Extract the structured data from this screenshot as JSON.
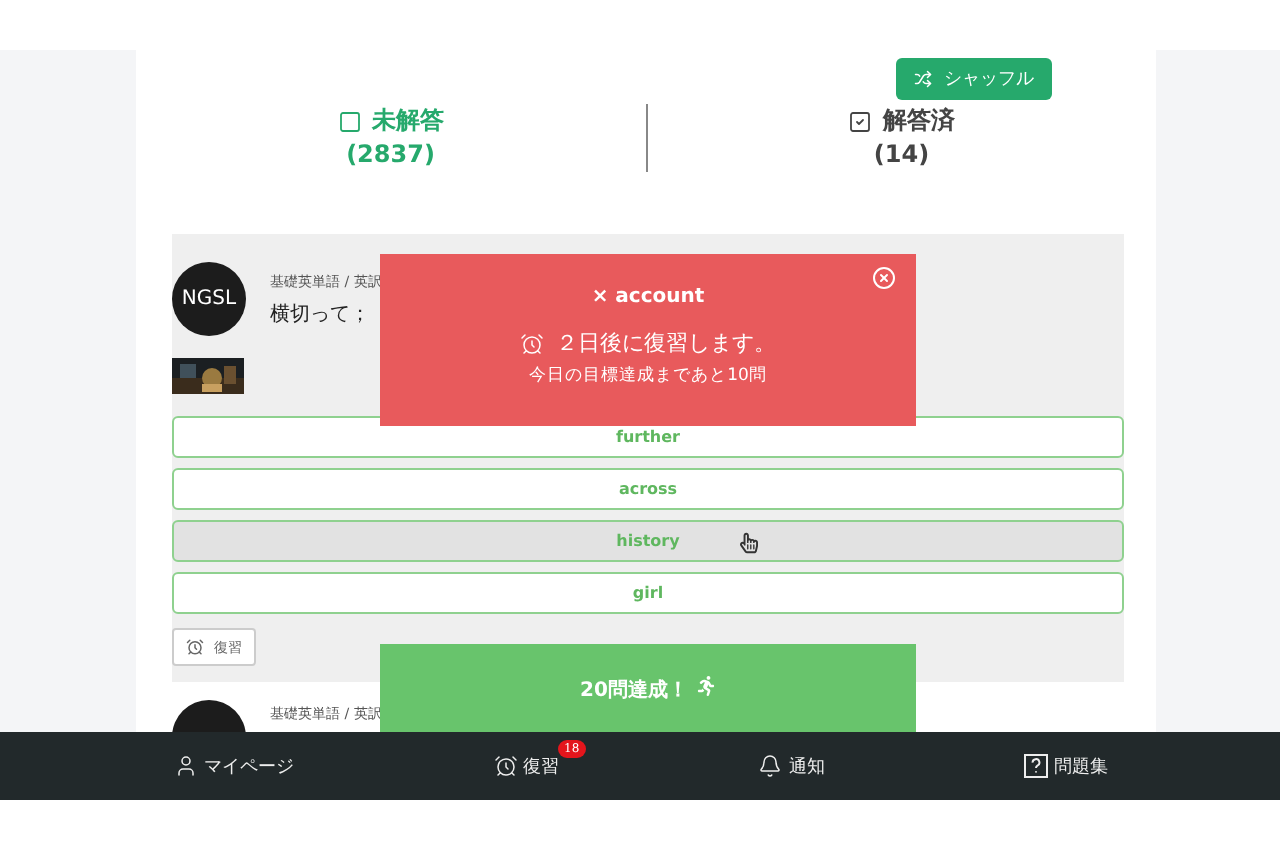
{
  "toolbar": {
    "shuffle_button": "シャッフル"
  },
  "tabs": [
    {
      "kind": "unanswered",
      "label": "未解答",
      "count": "(2837)",
      "selected": true
    },
    {
      "kind": "answered",
      "label": "解答済",
      "count": "(14)",
      "selected": false
    }
  ],
  "card": {
    "avatar": "NGSL",
    "breadcrumb": "基礎英単語 / 英訳",
    "question": "横切って；",
    "choices": [
      {
        "label": "further",
        "hovered": false
      },
      {
        "label": "across",
        "hovered": false
      },
      {
        "label": "history",
        "hovered": true
      },
      {
        "label": "girl",
        "hovered": false
      }
    ],
    "review_button": "復習"
  },
  "next_card": {
    "breadcrumb": "基礎英単語 / 英訳"
  },
  "review_toast": {
    "title": "× account",
    "message": "２日後に復習します。",
    "goal": "今日の目標達成まであと10問"
  },
  "achievement_toast": {
    "text": "20問達成！"
  },
  "bottom_nav": [
    {
      "kind": "user",
      "label": "マイページ"
    },
    {
      "kind": "alarm",
      "label": "復習",
      "badge": "18"
    },
    {
      "kind": "bell",
      "label": "通知"
    },
    {
      "kind": "help",
      "label": "問題集"
    }
  ]
}
